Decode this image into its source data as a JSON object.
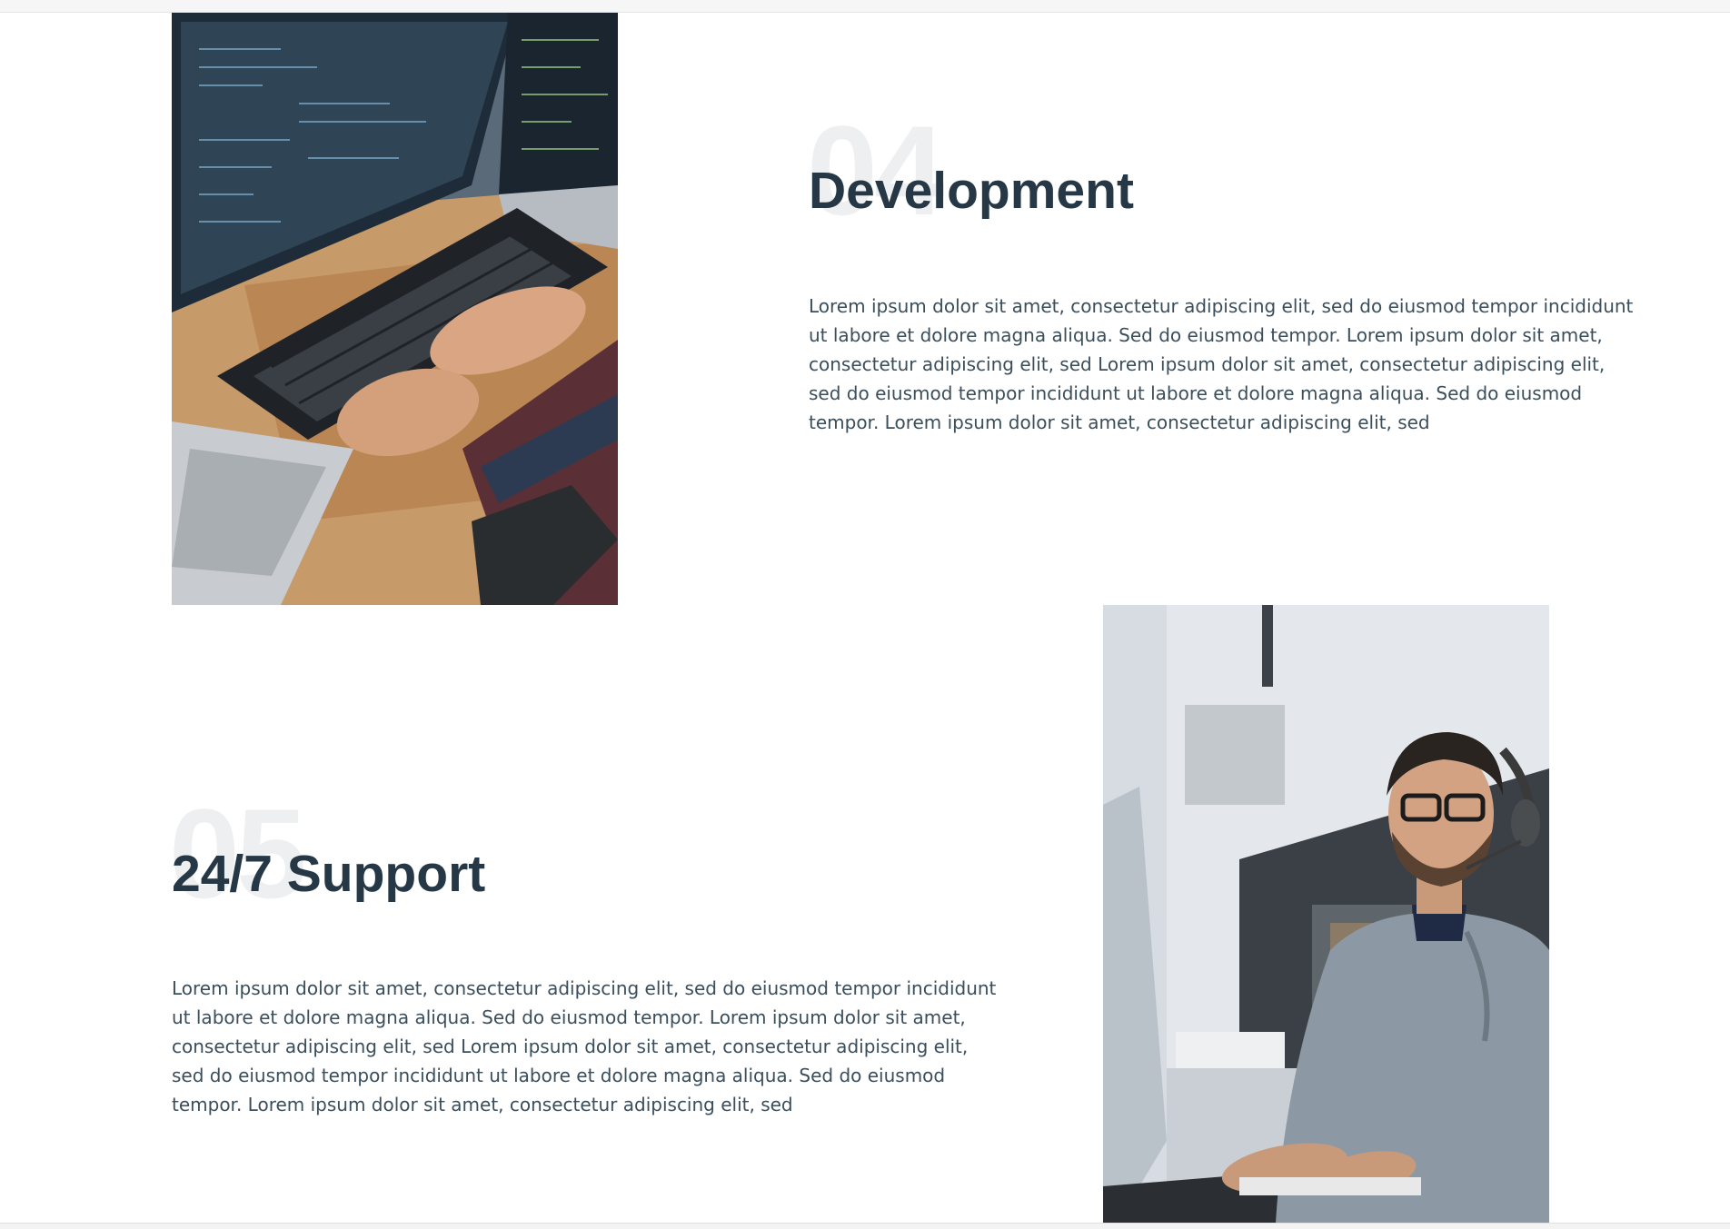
{
  "sections": [
    {
      "number": "04",
      "title": "Development",
      "lines": [
        "Lorem ipsum dolor sit amet, consectetur adipiscing elit, sed do eiusmod tempor incididunt",
        "ut labore et dolore magna aliqua. Sed do eiusmod tempor. Lorem ipsum dolor sit amet,",
        "consectetur adipiscing elit, sed  Lorem ipsum dolor sit amet, consectetur adipiscing elit,",
        "sed do eiusmod tempor incididunt ut labore et dolore magna aliqua. Sed do eiusmod",
        "tempor. Lorem ipsum dolor sit amet, consectetur adipiscing elit, sed"
      ],
      "image": "developer-typing-on-keyboard-photo"
    },
    {
      "number": "05",
      "title": "24/7 Support",
      "lines": [
        "Lorem ipsum dolor sit amet, consectetur adipiscing elit, sed do eiusmod tempor incididunt",
        "ut labore et dolore magna aliqua. Sed do eiusmod tempor. Lorem ipsum dolor sit amet,",
        "consectetur adipiscing elit, sed  Lorem ipsum dolor sit amet, consectetur adipiscing elit,",
        "sed do eiusmod tempor incididunt ut labore et dolore magna aliqua. Sed do eiusmod",
        "tempor. Lorem ipsum dolor sit amet, consectetur adipiscing elit, sed"
      ],
      "image": "support-agent-with-headset-photo"
    }
  ],
  "colors": {
    "heading": "#263845",
    "body_text": "#3a4e5c",
    "watermark_number": "#eeeff0",
    "background": "#ffffff"
  }
}
